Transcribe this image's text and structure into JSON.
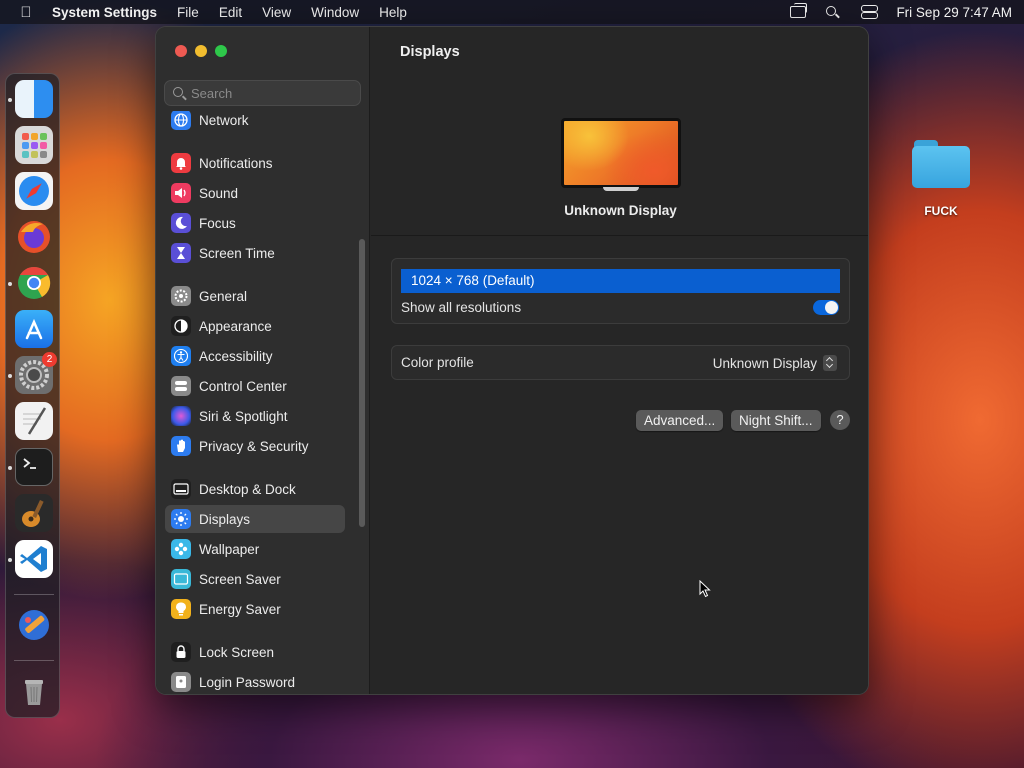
{
  "menubar": {
    "app_name": "System Settings",
    "menus": [
      "File",
      "Edit",
      "View",
      "Window",
      "Help"
    ],
    "clock": "Fri Sep 29  7:47 AM"
  },
  "dock": {
    "apps": [
      {
        "name": "finder-icon",
        "color": "#2d8ef0"
      },
      {
        "name": "launchpad-icon",
        "color": "#d9d9d9"
      },
      {
        "name": "safari-icon",
        "color": "#2a8cf0"
      },
      {
        "name": "firefox-icon",
        "color": "#e6502a"
      },
      {
        "name": "chrome-icon",
        "color": "#e8e8e8"
      },
      {
        "name": "app-store-icon",
        "color": "#1a8cf2"
      },
      {
        "name": "system-settings-icon",
        "color": "#7c7c7c",
        "badge": "2"
      },
      {
        "name": "textedit-icon",
        "color": "#f2f2f2"
      },
      {
        "name": "terminal-icon",
        "color": "#1d1d1d"
      },
      {
        "name": "garageband-icon",
        "color": "#333333"
      },
      {
        "name": "vscode-icon",
        "color": "#1f7fd0"
      },
      {
        "name": "notes-pencil-icon",
        "color": "#2f6ed6"
      },
      {
        "name": "trash-icon",
        "color": "#9a9a9a"
      }
    ]
  },
  "desktop": {
    "folder_label": "FUCK"
  },
  "sidebar": {
    "search_placeholder": "Search",
    "items": [
      {
        "label": "Network",
        "icon": "globe-icon",
        "color": "#2d7cf0"
      },
      {
        "label": "Notifications",
        "icon": "bell-icon",
        "color": "#ee3b40"
      },
      {
        "label": "Sound",
        "icon": "speaker-icon",
        "color": "#ee3b60"
      },
      {
        "label": "Focus",
        "icon": "moon-icon",
        "color": "#5a4fd6"
      },
      {
        "label": "Screen Time",
        "icon": "hourglass-icon",
        "color": "#5a4fd6"
      },
      {
        "label": "General",
        "icon": "gear-icon",
        "color": "#8a8a8a"
      },
      {
        "label": "Appearance",
        "icon": "appearance-icon",
        "color": "#1f1f1f"
      },
      {
        "label": "Accessibility",
        "icon": "accessibility-icon",
        "color": "#1f7ff0"
      },
      {
        "label": "Control Center",
        "icon": "control-center-icon",
        "color": "#8a8a8a"
      },
      {
        "label": "Siri & Spotlight",
        "icon": "siri-icon",
        "color": "#b03ad6"
      },
      {
        "label": "Privacy & Security",
        "icon": "hand-icon",
        "color": "#2d7cf0"
      },
      {
        "label": "Desktop & Dock",
        "icon": "dock-icon",
        "color": "#1f1f1f"
      },
      {
        "label": "Displays",
        "icon": "sun-icon",
        "color": "#2d7cf0"
      },
      {
        "label": "Wallpaper",
        "icon": "wallpaper-icon",
        "color": "#3ab8e8"
      },
      {
        "label": "Screen Saver",
        "icon": "screensaver-icon",
        "color": "#3ab8d8"
      },
      {
        "label": "Energy Saver",
        "icon": "lightbulb-icon",
        "color": "#f2b21c"
      },
      {
        "label": "Lock Screen",
        "icon": "lock-icon",
        "color": "#1f1f1f"
      },
      {
        "label": "Login Password",
        "icon": "login-password-icon",
        "color": "#8a8a8a"
      }
    ],
    "selected": "Displays"
  },
  "main": {
    "title": "Displays",
    "display_name": "Unknown Display",
    "resolution": "1024 × 768 (Default)",
    "show_all_label": "Show all resolutions",
    "show_all_enabled": true,
    "color_profile_label": "Color profile",
    "color_profile_value": "Unknown Display",
    "advanced_button": "Advanced...",
    "night_shift_button": "Night Shift...",
    "help_button": "?"
  }
}
